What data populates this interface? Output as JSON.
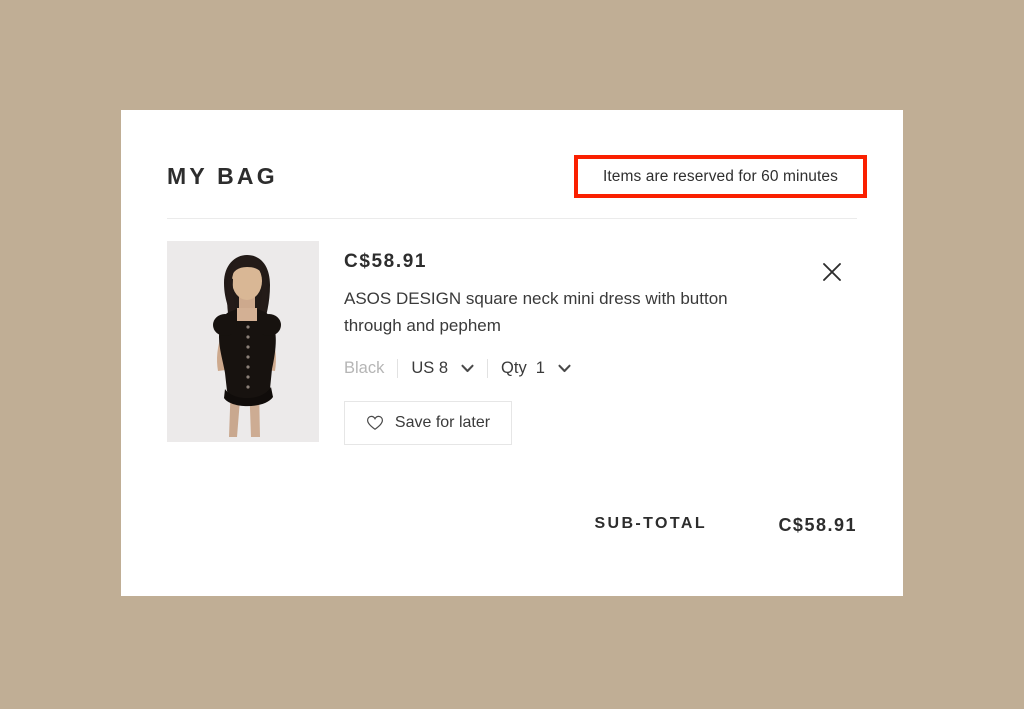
{
  "page": {
    "background_color": "#c0ae95",
    "card_background": "#ffffff"
  },
  "header": {
    "title": "MY BAG",
    "reservation_notice": "Items are reserved for 60 minutes",
    "annotation_color": "#fa2000"
  },
  "product": {
    "price": "C$58.91",
    "name": "ASOS DESIGN square neck mini dress with button through and pephem",
    "image_alt": "model-wearing-black-button-through-mini-dress",
    "variants": {
      "color": "Black",
      "size_label": "US 8",
      "qty_label": "Qty",
      "qty_value": "1"
    },
    "save_for_later_label": "Save for later",
    "remove_icon": "close-icon",
    "heart_icon": "heart-outline-icon",
    "chevron_icon": "chevron-down-icon"
  },
  "summary": {
    "subtotal_label": "SUB-TOTAL",
    "subtotal_value": "C$58.91"
  }
}
